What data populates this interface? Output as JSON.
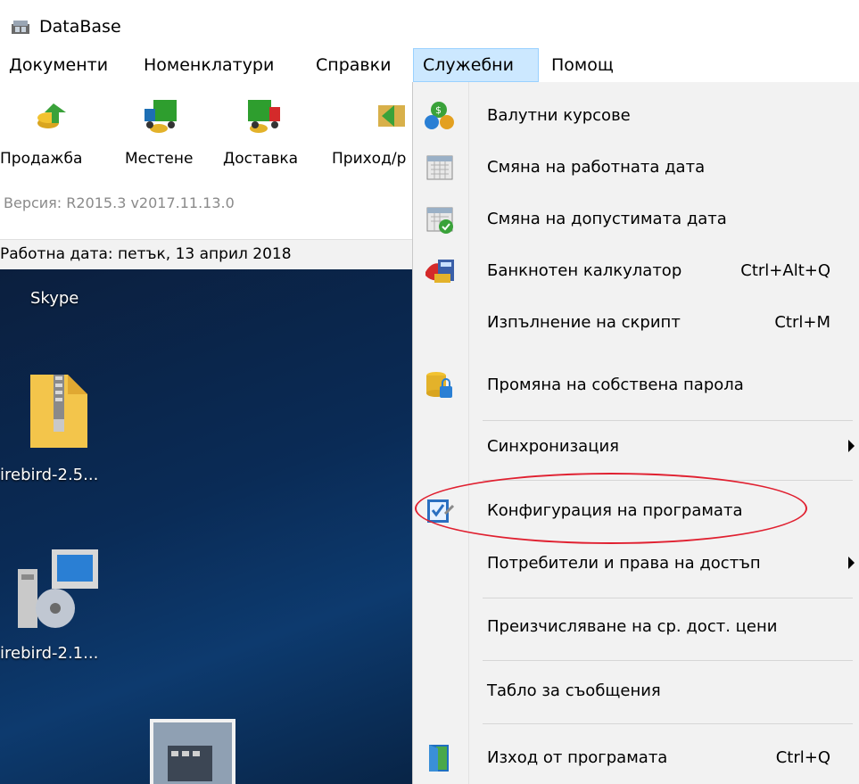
{
  "window": {
    "title": "DataBase",
    "icon": "database-app-icon"
  },
  "menubar": {
    "items": [
      {
        "label": "Документи"
      },
      {
        "label": "Номенклатури"
      },
      {
        "label": "Справки"
      },
      {
        "label": "Служебни",
        "active": true
      },
      {
        "label": "Помощ"
      }
    ]
  },
  "toolbar": {
    "buttons": [
      {
        "label": "Продажба",
        "icon": "sale-coins-icon"
      },
      {
        "label": "Местене",
        "icon": "truck-green-icon"
      },
      {
        "label": "Доставка",
        "icon": "truck-red-icon"
      },
      {
        "label": "Приход/р",
        "icon": "income-icon"
      }
    ]
  },
  "status": {
    "version": "Версия: R2015.3 v2017.11.13.0",
    "work_date": "Работна дата: петък, 13 април 2018"
  },
  "desktop": {
    "icons": [
      {
        "label": "Skype",
        "icon": "skype-icon"
      },
      {
        "label": "irebird-2.5...",
        "icon": "zip-folder-icon"
      },
      {
        "label": "irebird-2.1...",
        "icon": "installer-icon"
      },
      {
        "label": "",
        "icon": "calculator-photo-icon"
      }
    ]
  },
  "dropdown": {
    "items": [
      {
        "label": "Валутни курсове",
        "shortcut": "",
        "icon": "currency-icon"
      },
      {
        "label": "Смяна на работната дата",
        "shortcut": "",
        "icon": "calendar-icon"
      },
      {
        "label": "Смяна на допустимата дата",
        "shortcut": "",
        "icon": "calendar-check-icon"
      },
      {
        "label": "Банкнотен калкулатор",
        "shortcut": "Ctrl+Alt+Q",
        "icon": "banknote-calculator-icon"
      },
      {
        "label": "Изпълнение на скрипт",
        "shortcut": "Ctrl+M",
        "icon": ""
      },
      {
        "label": "Промяна на собствена парола",
        "shortcut": "",
        "icon": "database-lock-icon"
      },
      {
        "label": "Синхронизация",
        "shortcut": "",
        "icon": "",
        "submenu": true
      },
      {
        "label": "Конфигурация на програмата",
        "shortcut": "",
        "icon": "configuration-checklist-icon",
        "highlighted": true
      },
      {
        "label": "Потребители и права на достъп",
        "shortcut": "",
        "icon": "",
        "submenu": true
      },
      {
        "label": "Преизчисляване на ср. дост. цени",
        "shortcut": "",
        "icon": ""
      },
      {
        "label": "Табло за съобщения",
        "shortcut": "",
        "icon": ""
      },
      {
        "label": "Изход от програмата",
        "shortcut": "Ctrl+Q",
        "icon": "exit-door-icon"
      }
    ]
  },
  "colors": {
    "menu_active_bg": "#cce8ff",
    "highlight_outline": "#e02030",
    "desktop_bg": "#0a2b56"
  }
}
